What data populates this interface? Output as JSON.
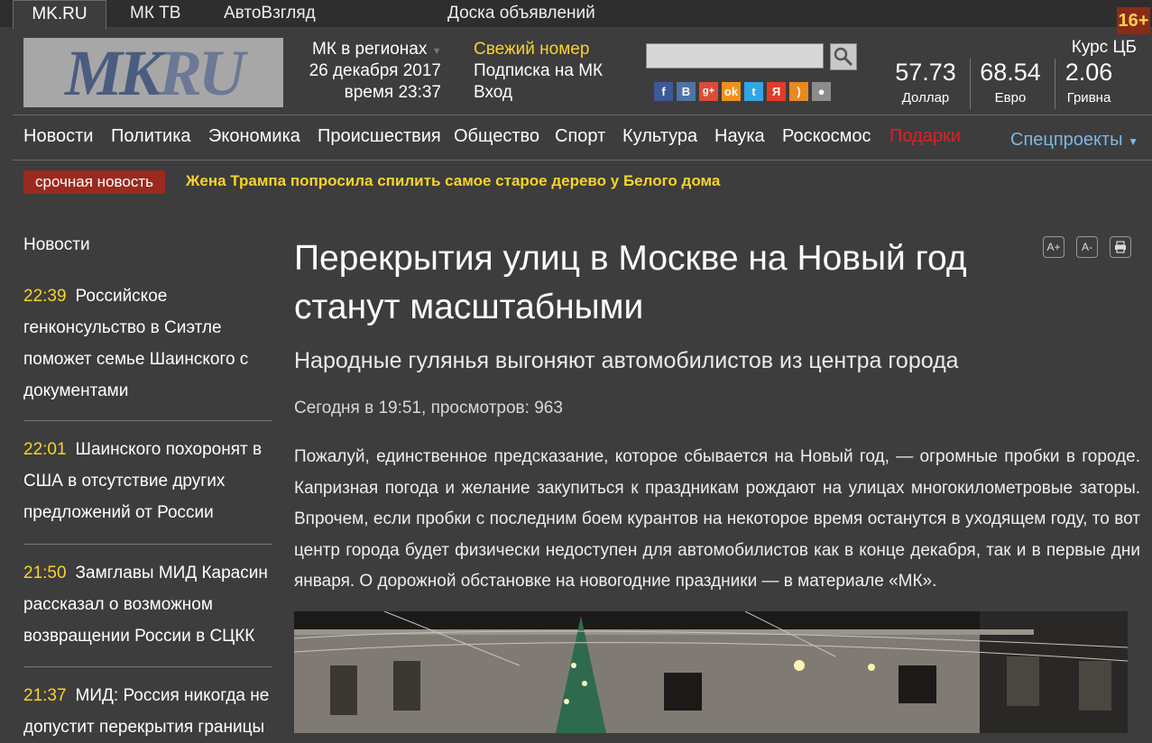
{
  "top_nav": {
    "items": [
      "MK.RU",
      "МК ТВ",
      "АвтоВзгляд",
      "Доска объявлений"
    ],
    "age_badge": "16+"
  },
  "header": {
    "logo_mk": "MK",
    "logo_ru": "RU",
    "regions_label": "МК в регионах",
    "date": "26 декабря 2017",
    "time": "время 23:37",
    "fresh_issue": "Свежий номер",
    "subscribe": "Подписка на МК",
    "login": "Вход",
    "search_placeholder": "",
    "social_icons": [
      "facebook-icon",
      "vk-icon",
      "google-plus-icon",
      "odnoklassniki-icon",
      "twitter-icon",
      "yandex-icon",
      "rss-icon",
      "apple-icon"
    ]
  },
  "rates": {
    "title": "Курс ЦБ",
    "items": [
      {
        "value": "57.73",
        "label": "Доллар"
      },
      {
        "value": "68.54",
        "label": "Евро"
      },
      {
        "value": "2.06",
        "label": "Гривна"
      }
    ]
  },
  "main_nav": {
    "items": [
      "Новости",
      "Политика",
      "Экономика",
      "Происшествия",
      "Общество",
      "Спорт",
      "Культура",
      "Наука",
      "Роскосмос",
      "Подарки"
    ],
    "special": "Спецпроекты"
  },
  "breaking": {
    "label": "срочная новость",
    "text": "Жена Трампа попросила спилить самое старое дерево у Белого дома"
  },
  "sidebar": {
    "title": "Новости",
    "items": [
      {
        "time": "22:39",
        "text": "Российское генконсульство в Сиэтле поможет семье Шаинского с документами"
      },
      {
        "time": "22:01",
        "text": "Шаинского похоронят в США в отсутствие других предложений от России"
      },
      {
        "time": "21:50",
        "text": "Замглавы МИД Карасин рассказал о возможном возвращении России в СЦКК"
      },
      {
        "time": "21:37",
        "text": "МИД: Россия никогда не допустит перекрытия границы"
      }
    ]
  },
  "article": {
    "title": "Перекрытия улиц в Москве на Новый год станут масштабными",
    "subtitle": "Народные гулянья выгоняют автомобилистов из центра города",
    "meta": "Сегодня в 19:51, просмотров: 963",
    "lead": "Пожалуй, единственное предсказание, которое сбывается на Новый год, — огромные пробки в городе. Капризная погода и желание закупиться к праздникам рождают на улицах многокилометровые заторы. Впрочем, если пробки с последним боем курантов на некоторое время останутся в уходящем году, то вот центр города будет физически недоступен для автомобилистов как в конце декабря, так и в первые дни января. О дорожной обстановке на новогодние праздники — в материале «МК».",
    "tools": [
      "A+",
      "A-"
    ]
  },
  "colors": {
    "background": "#3d3d3d",
    "accent_yellow": "#f6d42a",
    "breaking_red": "#9a2a1f",
    "gifts_red": "#e02020",
    "special_blue": "#7ab8e8"
  }
}
